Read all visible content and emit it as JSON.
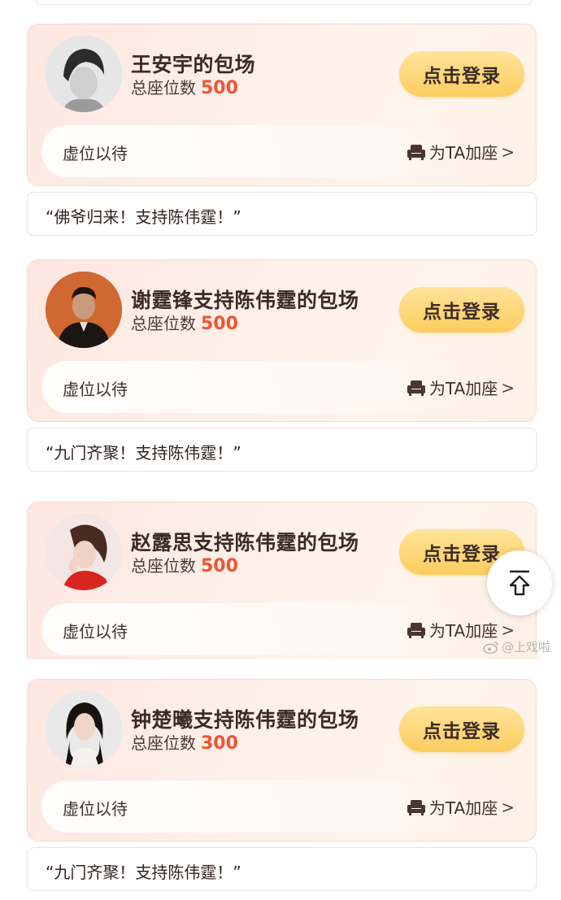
{
  "cards": [
    {
      "title": "王安宇的包场",
      "seats_label": "总座位数",
      "seats_count": "500",
      "login_label": "点击登录",
      "wait_label": "虚位以待",
      "add_seat_label": "为TA加座",
      "chevron": ">"
    },
    {
      "title": "谢霆锋支持陈伟霆的包场",
      "seats_label": "总座位数",
      "seats_count": "500",
      "login_label": "点击登录",
      "wait_label": "虚位以待",
      "add_seat_label": "为TA加座",
      "chevron": ">"
    },
    {
      "title": "赵露思支持陈伟霆的包场",
      "seats_label": "总座位数",
      "seats_count": "500",
      "login_label": "点击登录",
      "wait_label": "虚位以待",
      "add_seat_label": "为TA加座",
      "chevron": ">"
    },
    {
      "title": "钟楚曦支持陈伟霆的包场",
      "seats_label": "总座位数",
      "seats_count": "300",
      "login_label": "点击登录",
      "wait_label": "虚位以待",
      "add_seat_label": "为TA加座",
      "chevron": ">"
    }
  ],
  "quotes": [
    "“佛爷归来！支持陈伟霆！”",
    "“九门齐聚！支持陈伟霆！”",
    "“九门齐聚！支持陈伟霆！”"
  ],
  "watermark": "@上戏啦",
  "icons": {
    "seat": "armchair-icon",
    "scroll_top": "arrow-up-to-top-icon",
    "weibo": "weibo-logo-icon"
  },
  "colors": {
    "seat_count": "#ee5532",
    "login_button": "#fbcd5e",
    "card_bg": "#fde6df"
  }
}
